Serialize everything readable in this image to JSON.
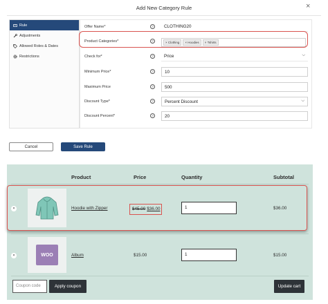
{
  "modal": {
    "title": "Add New Category Rule",
    "close_label": "×"
  },
  "tabs": [
    {
      "label": "Rule",
      "icon": "ruler-icon",
      "active": true
    },
    {
      "label": "Adjustments",
      "icon": "wrench-icon",
      "active": false
    },
    {
      "label": "Allowed Roles & Dates",
      "icon": "tag-icon",
      "active": false
    },
    {
      "label": "Restrictions",
      "icon": "gear-icon",
      "active": false
    }
  ],
  "form": {
    "offer_name": {
      "label": "Offer Name*",
      "value": "CLOTHING20"
    },
    "product_categories": {
      "label": "Product Categories*",
      "tags": [
        "× Clothing",
        "× Hoodies",
        "× Tshirts"
      ]
    },
    "check_for": {
      "label": "Check for*",
      "value": "Price"
    },
    "minimum_price": {
      "label": "Minimum Price*",
      "value": "10"
    },
    "maximum_price": {
      "label": "Maximum Price",
      "value": "500"
    },
    "discount_type": {
      "label": "Discount Type*",
      "value": "Percent Discount"
    },
    "discount_percent": {
      "label": "Discount Percent*",
      "value": "20"
    },
    "help_glyph": "?"
  },
  "buttons": {
    "cancel": "Cancel",
    "save": "Save Rule"
  },
  "cart": {
    "headers": {
      "product": "Product",
      "price": "Price",
      "quantity": "Quantity",
      "subtotal": "Subtotal"
    },
    "items": [
      {
        "name": "Hoodie with Zipper",
        "old_price": "$45.00",
        "new_price": "$36.00",
        "quantity": "1",
        "subtotal": "$36.00",
        "remove": "×"
      },
      {
        "name": "Album",
        "price": "$15.00",
        "quantity": "1",
        "subtotal": "$15.00",
        "remove": "×",
        "thumb_text": "WOO"
      }
    ],
    "coupon_placeholder": "Coupon code",
    "apply_coupon": "Apply coupon",
    "update_cart": "Update cart"
  },
  "colors": {
    "brand": "#25497a",
    "highlight": "#d9534f",
    "cart_bg": "#cfe3dc",
    "dark_button": "#2e3338"
  }
}
